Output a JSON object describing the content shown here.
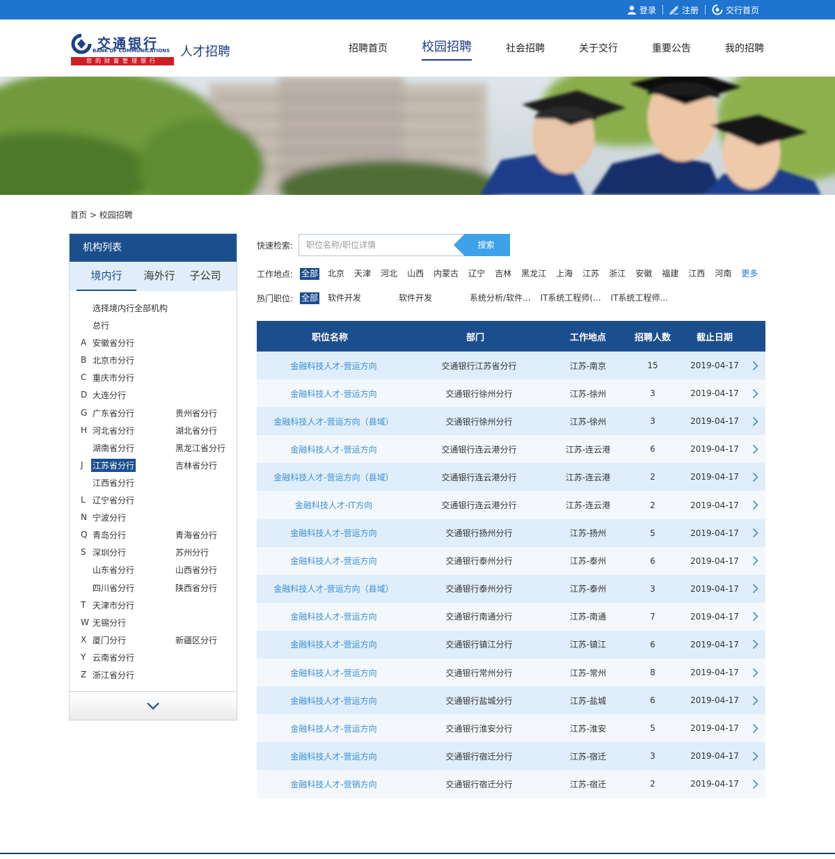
{
  "topbar": {
    "login": "登录",
    "register": "注册",
    "home": "交行首页"
  },
  "header": {
    "logo_cn": "交通银行",
    "logo_en": "BANK OF COMMUNICATIONS",
    "logo_slogan": "您的财富管理银行",
    "site_name": "人才招聘",
    "nav": [
      {
        "label": "招聘首页"
      },
      {
        "label": "校园招聘"
      },
      {
        "label": "社会招聘"
      },
      {
        "label": "关于交行"
      },
      {
        "label": "重要公告"
      },
      {
        "label": "我的招聘"
      }
    ]
  },
  "breadcrumb": "首页 > 校园招聘",
  "sidebar": {
    "title": "机构列表",
    "tabs": [
      "境内行",
      "海外行",
      "子公司"
    ],
    "rows": [
      {
        "letter": "",
        "c1": "选择境内行全部机构",
        "c2": ""
      },
      {
        "letter": "",
        "c1": "总行",
        "c2": ""
      },
      {
        "letter": "A",
        "c1": "安徽省分行",
        "c2": ""
      },
      {
        "letter": "B",
        "c1": "北京市分行",
        "c2": ""
      },
      {
        "letter": "C",
        "c1": "重庆市分行",
        "c2": ""
      },
      {
        "letter": "D",
        "c1": "大连分行",
        "c2": ""
      },
      {
        "letter": "G",
        "c1": "广东省分行",
        "c2": "贵州省分行"
      },
      {
        "letter": "H",
        "c1": "河北省分行",
        "c2": "湖北省分行"
      },
      {
        "letter": "",
        "c1": "湖南省分行",
        "c2": "黑龙江省分行"
      },
      {
        "letter": "J",
        "c1": "江苏省分行",
        "c2": "吉林省分行"
      },
      {
        "letter": "",
        "c1": "江西省分行",
        "c2": ""
      },
      {
        "letter": "L",
        "c1": "辽宁省分行",
        "c2": ""
      },
      {
        "letter": "N",
        "c1": "宁波分行",
        "c2": ""
      },
      {
        "letter": "Q",
        "c1": "青岛分行",
        "c2": "青海省分行"
      },
      {
        "letter": "S",
        "c1": "深圳分行",
        "c2": "苏州分行"
      },
      {
        "letter": "",
        "c1": "山东省分行",
        "c2": "山西省分行"
      },
      {
        "letter": "",
        "c1": "四川省分行",
        "c2": "陕西省分行"
      },
      {
        "letter": "T",
        "c1": "天津市分行",
        "c2": ""
      },
      {
        "letter": "W",
        "c1": "无锡分行",
        "c2": ""
      },
      {
        "letter": "X",
        "c1": "厦门分行",
        "c2": "新疆区分行"
      },
      {
        "letter": "Y",
        "c1": "云南省分行",
        "c2": ""
      },
      {
        "letter": "Z",
        "c1": "浙江省分行",
        "c2": ""
      }
    ]
  },
  "search": {
    "label": "快速检索:",
    "placeholder": "职位名称/职位详情",
    "button": "搜索"
  },
  "filters": {
    "location_label": "工作地点:",
    "locations": [
      "全部",
      "北京",
      "天津",
      "河北",
      "山西",
      "内蒙古",
      "辽宁",
      "吉林",
      "黑龙江",
      "上海",
      "江苏",
      "浙江",
      "安徽",
      "福建",
      "江西",
      "河南",
      "更多"
    ],
    "job_label": "热门职位:",
    "jobs": [
      "全部",
      "软件开发",
      "软件开发",
      "系统分析/软件...",
      "IT系统工程师(...",
      "IT系统工程师..."
    ]
  },
  "table": {
    "headers": [
      "职位名称",
      "部门",
      "工作地点",
      "招聘人数",
      "截止日期"
    ],
    "rows": [
      {
        "title": "金融科技人才-营运方向",
        "dept": "交通银行江苏省分行",
        "loc": "江苏-南京",
        "count": "15",
        "date": "2019-04-17"
      },
      {
        "title": "金融科技人才-营运方向",
        "dept": "交通银行徐州分行",
        "loc": "江苏-徐州",
        "count": "3",
        "date": "2019-04-17"
      },
      {
        "title": "金融科技人才-营运方向（县域）",
        "dept": "交通银行徐州分行",
        "loc": "江苏-徐州",
        "count": "3",
        "date": "2019-04-17"
      },
      {
        "title": "金融科技人才-营运方向",
        "dept": "交通银行连云港分行",
        "loc": "江苏-连云港",
        "count": "6",
        "date": "2019-04-17"
      },
      {
        "title": "金融科技人才-营运方向（县域）",
        "dept": "交通银行连云港分行",
        "loc": "江苏-连云港",
        "count": "2",
        "date": "2019-04-17"
      },
      {
        "title": "金融科技人才-IT方向",
        "dept": "交通银行连云港分行",
        "loc": "江苏-连云港",
        "count": "2",
        "date": "2019-04-17"
      },
      {
        "title": "金融科技人才-营运方向",
        "dept": "交通银行扬州分行",
        "loc": "江苏-扬州",
        "count": "5",
        "date": "2019-04-17"
      },
      {
        "title": "金融科技人才-营运方向",
        "dept": "交通银行泰州分行",
        "loc": "江苏-泰州",
        "count": "6",
        "date": "2019-04-17"
      },
      {
        "title": "金融科技人才-营运方向（县域）",
        "dept": "交通银行泰州分行",
        "loc": "江苏-泰州",
        "count": "3",
        "date": "2019-04-17"
      },
      {
        "title": "金融科技人才-营运方向",
        "dept": "交通银行南通分行",
        "loc": "江苏-南通",
        "count": "7",
        "date": "2019-04-17"
      },
      {
        "title": "金融科技人才-营运方向",
        "dept": "交通银行镇江分行",
        "loc": "江苏-镇江",
        "count": "6",
        "date": "2019-04-17"
      },
      {
        "title": "金融科技人才-营运方向",
        "dept": "交通银行常州分行",
        "loc": "江苏-常州",
        "count": "8",
        "date": "2019-04-17"
      },
      {
        "title": "金融科技人才-营运方向",
        "dept": "交通银行盐城分行",
        "loc": "江苏-盐城",
        "count": "6",
        "date": "2019-04-17"
      },
      {
        "title": "金融科技人才-营运方向",
        "dept": "交通银行淮安分行",
        "loc": "江苏-淮安",
        "count": "5",
        "date": "2019-04-17"
      },
      {
        "title": "金融科技人才-营运方向",
        "dept": "交通银行宿迁分行",
        "loc": "江苏-宿迁",
        "count": "3",
        "date": "2019-04-17"
      },
      {
        "title": "金融科技人才-营销方向",
        "dept": "交通银行宿迁分行",
        "loc": "江苏-宿迁",
        "count": "2",
        "date": "2019-04-17"
      }
    ]
  },
  "icons": {
    "login": "user-icon",
    "register": "pen-icon",
    "home": "bank-logo-icon",
    "row_arrow": "chevron-right-icon",
    "expand": "chevron-down-icon"
  },
  "colors": {
    "topbar": "#1f74cf",
    "primary": "#1b4e8d",
    "link": "#3b8fd1",
    "search_button": "#3ea2e8",
    "row_odd": "#dfeefa",
    "row_even": "#f3f8fc",
    "brand_red": "#d11d24"
  }
}
